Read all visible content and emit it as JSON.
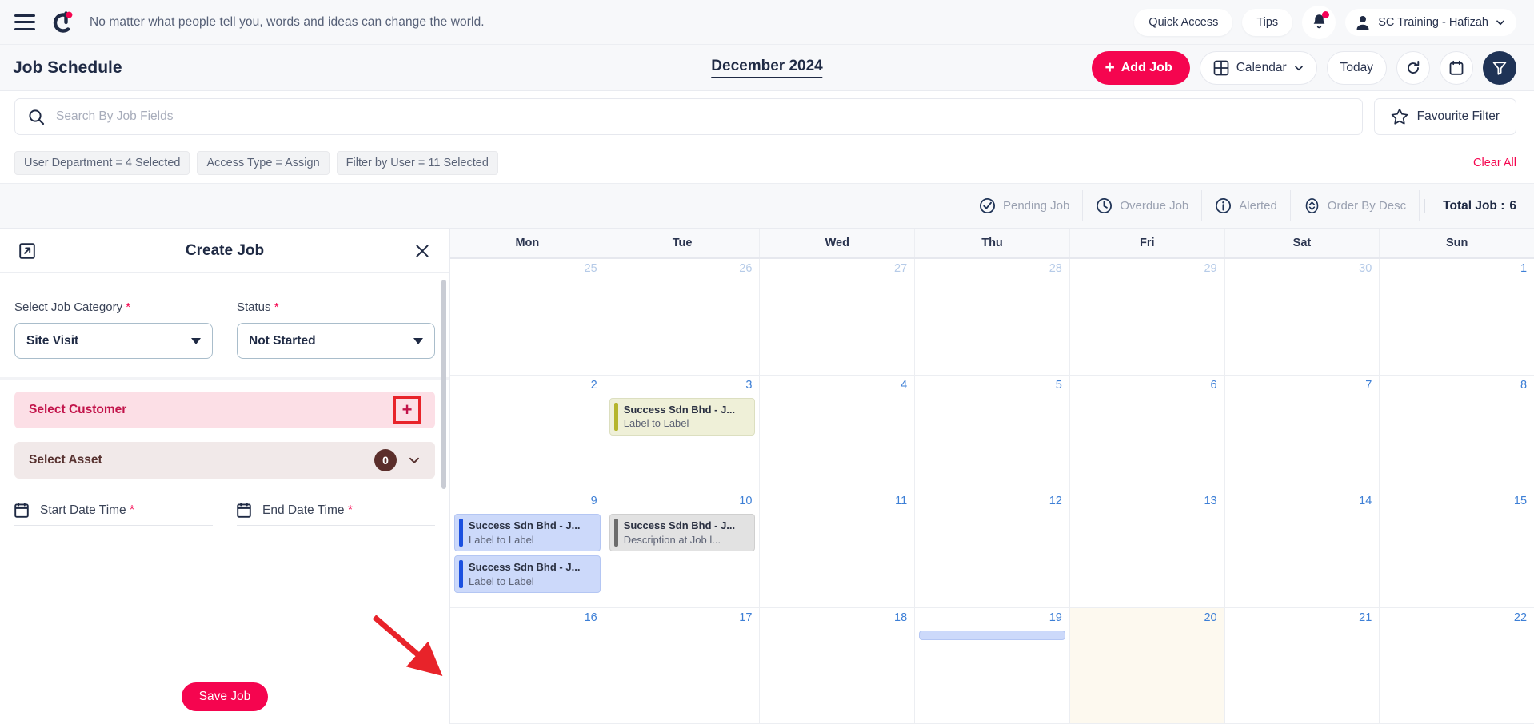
{
  "topbar": {
    "tagline": "No matter what people tell you, words and ideas can change the world.",
    "quick_access": "Quick Access",
    "tips": "Tips",
    "user": "SC Training - Hafizah"
  },
  "header": {
    "page_title": "Job Schedule",
    "month": "December 2024",
    "add_job": "Add Job",
    "view_mode": "Calendar",
    "today": "Today"
  },
  "search": {
    "placeholder": "Search By Job Fields",
    "value": "",
    "favourite_filter": "Favourite Filter"
  },
  "filters": {
    "chips": [
      "User Department  =  4 Selected",
      "Access Type  =  Assign",
      "Filter by User  =  11 Selected"
    ],
    "clear_all": "Clear All"
  },
  "status_bar": {
    "pending_job": "Pending Job",
    "overdue_job": "Overdue Job",
    "alerted": "Alerted",
    "order_by": "Order By Desc",
    "total_job_label": "Total Job :",
    "total_job_value": "6"
  },
  "create_job": {
    "title": "Create Job",
    "job_category_label": "Select Job Category",
    "job_category_value": "Site Visit",
    "status_label": "Status",
    "status_value": "Not Started",
    "select_customer": "Select Customer",
    "select_asset": "Select Asset",
    "asset_count": "0",
    "start_date_label": "Start Date Time",
    "end_date_label": "End Date Time",
    "save": "Save Job",
    "required_mark": "*"
  },
  "calendar": {
    "weekdays": [
      "Mon",
      "Tue",
      "Wed",
      "Thu",
      "Fri",
      "Sat",
      "Sun"
    ],
    "weeks": [
      {
        "days": [
          {
            "num": "25",
            "out": true,
            "hl": false,
            "events": []
          },
          {
            "num": "26",
            "out": true,
            "hl": false,
            "events": []
          },
          {
            "num": "27",
            "out": true,
            "hl": false,
            "events": []
          },
          {
            "num": "28",
            "out": true,
            "hl": false,
            "events": []
          },
          {
            "num": "29",
            "out": true,
            "hl": false,
            "events": []
          },
          {
            "num": "30",
            "out": true,
            "hl": false,
            "events": []
          },
          {
            "num": "1",
            "out": false,
            "hl": false,
            "events": []
          }
        ]
      },
      {
        "days": [
          {
            "num": "2",
            "out": false,
            "hl": false,
            "events": []
          },
          {
            "num": "3",
            "out": false,
            "hl": false,
            "events": [
              {
                "color": "olive",
                "title": "Success Sdn Bhd - J...",
                "sub": "Label to Label"
              }
            ]
          },
          {
            "num": "4",
            "out": false,
            "hl": false,
            "events": []
          },
          {
            "num": "5",
            "out": false,
            "hl": false,
            "events": []
          },
          {
            "num": "6",
            "out": false,
            "hl": false,
            "events": []
          },
          {
            "num": "7",
            "out": false,
            "hl": false,
            "events": []
          },
          {
            "num": "8",
            "out": false,
            "hl": false,
            "events": []
          }
        ]
      },
      {
        "days": [
          {
            "num": "9",
            "out": false,
            "hl": false,
            "events": [
              {
                "color": "blue",
                "title": "Success Sdn Bhd - J...",
                "sub": "Label to Label"
              },
              {
                "color": "blue",
                "title": "Success Sdn Bhd - J...",
                "sub": "Label to Label"
              }
            ]
          },
          {
            "num": "10",
            "out": false,
            "hl": false,
            "events": [
              {
                "color": "grey",
                "title": "Success Sdn Bhd - J...",
                "sub": "Description at Job l..."
              }
            ]
          },
          {
            "num": "11",
            "out": false,
            "hl": false,
            "events": []
          },
          {
            "num": "12",
            "out": false,
            "hl": false,
            "events": []
          },
          {
            "num": "13",
            "out": false,
            "hl": false,
            "events": []
          },
          {
            "num": "14",
            "out": false,
            "hl": false,
            "events": []
          },
          {
            "num": "15",
            "out": false,
            "hl": false,
            "events": []
          }
        ]
      },
      {
        "days": [
          {
            "num": "16",
            "out": false,
            "hl": false,
            "events": []
          },
          {
            "num": "17",
            "out": false,
            "hl": false,
            "events": []
          },
          {
            "num": "18",
            "out": false,
            "hl": false,
            "events": []
          },
          {
            "num": "19",
            "out": false,
            "hl": false,
            "events": [
              {
                "color": "blue",
                "title": "",
                "sub": ""
              }
            ]
          },
          {
            "num": "20",
            "out": false,
            "hl": true,
            "events": []
          },
          {
            "num": "21",
            "out": false,
            "hl": false,
            "events": []
          },
          {
            "num": "22",
            "out": false,
            "hl": false,
            "events": []
          }
        ]
      }
    ]
  },
  "colors": {
    "brand_pink": "#f5054f",
    "navy": "#1f2a44",
    "annotation_red": "#e8232a"
  }
}
